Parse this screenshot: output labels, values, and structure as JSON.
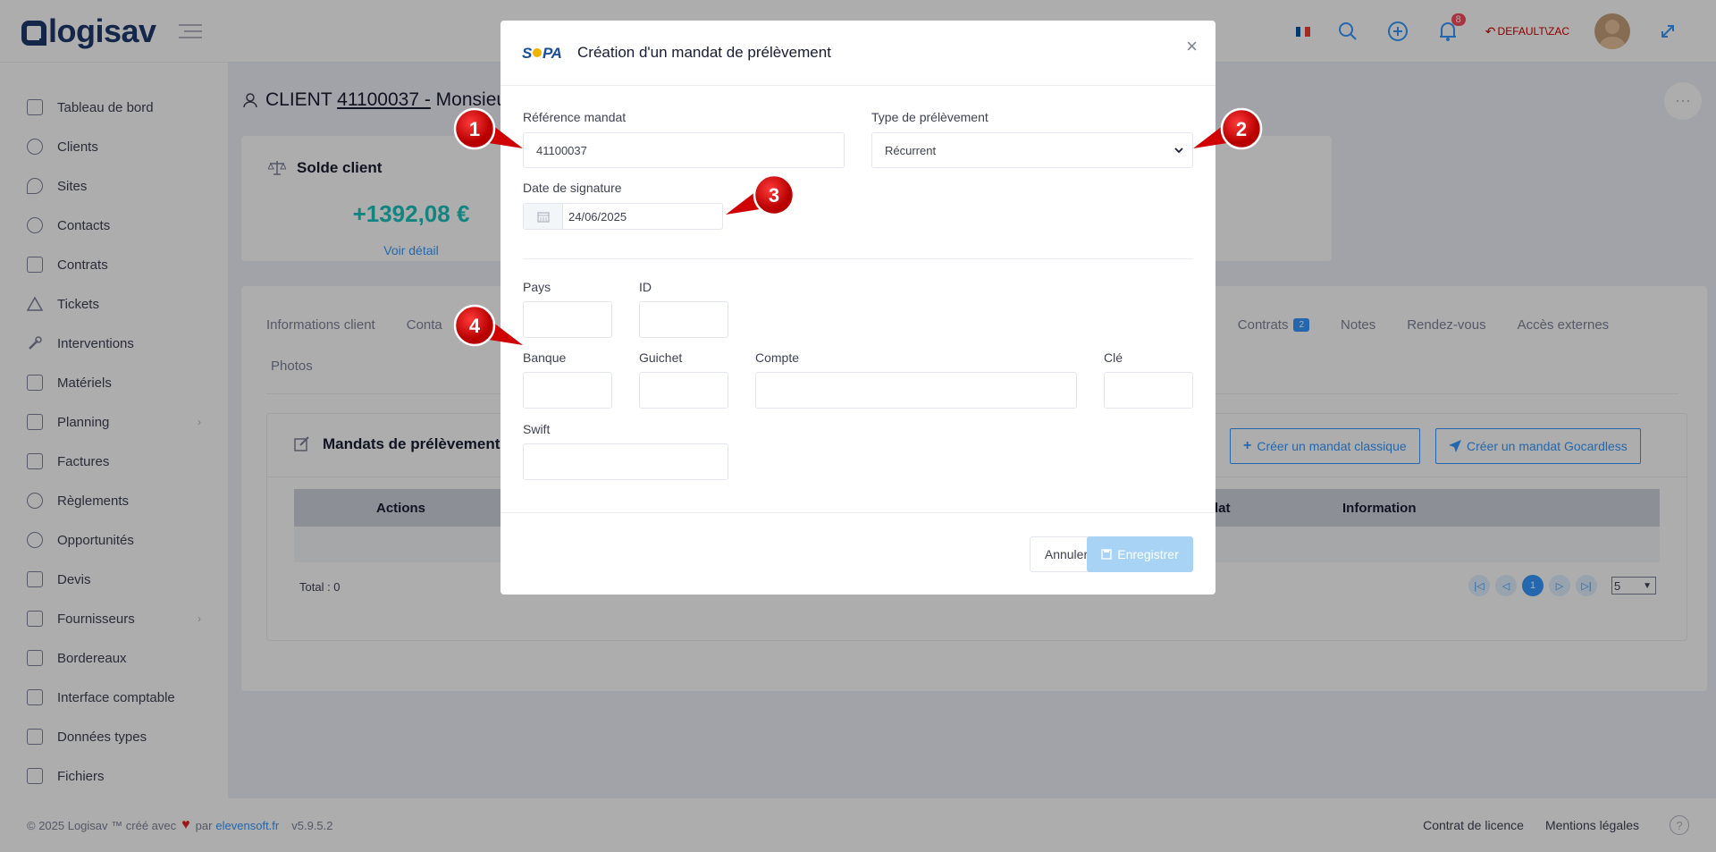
{
  "app": {
    "logo": "logisav",
    "user": "DEFAULT\\ZAC",
    "notifications": "8"
  },
  "sidebar": {
    "items": [
      {
        "label": "Tableau de bord"
      },
      {
        "label": "Clients"
      },
      {
        "label": "Sites"
      },
      {
        "label": "Contacts"
      },
      {
        "label": "Contrats"
      },
      {
        "label": "Tickets"
      },
      {
        "label": "Interventions"
      },
      {
        "label": "Matériels"
      },
      {
        "label": "Planning"
      },
      {
        "label": "Factures"
      },
      {
        "label": "Règlements"
      },
      {
        "label": "Opportunités"
      },
      {
        "label": "Devis"
      },
      {
        "label": "Fournisseurs"
      },
      {
        "label": "Bordereaux"
      },
      {
        "label": "Interface comptable"
      },
      {
        "label": "Données types"
      },
      {
        "label": "Fichiers"
      }
    ]
  },
  "page": {
    "title_prefix": "CLIENT ",
    "client_code": "41100037 -",
    "client_name": " Monsieur",
    "solde": {
      "title": "Solde client",
      "amount": "+1392,08 €",
      "link": "Voir détail"
    },
    "tabs": [
      {
        "label": "Informations client"
      },
      {
        "label": "Conta"
      },
      {
        "label": "Contrats",
        "badge": "2"
      },
      {
        "label": "Notes"
      },
      {
        "label": "Rendez-vous"
      },
      {
        "label": "Accès externes"
      },
      {
        "label": "Photos"
      }
    ],
    "mandats": {
      "title": "Mandats de prélèvement li",
      "btn_classique": "Créer un mandat classique",
      "btn_gocardless": "Créer un mandat Gocardless",
      "columns": [
        "Actions",
        "dat",
        "Information"
      ],
      "total": "Total : 0",
      "current_page": "1",
      "page_size": "5"
    }
  },
  "modal": {
    "logo": "SEPA",
    "title": "Création d'un mandat de prélèvement",
    "ref_label": "Référence mandat",
    "ref_value": "41100037",
    "type_label": "Type de prélèvement",
    "type_value": "Récurrent",
    "date_label": "Date de signature",
    "date_value": "24/06/2025",
    "pays_label": "Pays",
    "id_label": "ID",
    "banque_label": "Banque",
    "guichet_label": "Guichet",
    "compte_label": "Compte",
    "cle_label": "Clé",
    "swift_label": "Swift",
    "cancel": "Annuler",
    "save": "Enregistrer"
  },
  "callouts": [
    "1",
    "2",
    "3",
    "4"
  ],
  "footer": {
    "copyright": "© 2025 Logisav ™ créé avec",
    "par": "par",
    "link": "elevensoft.fr",
    "version": "v5.9.5.2",
    "licence": "Contrat de licence",
    "mentions": "Mentions légales"
  }
}
